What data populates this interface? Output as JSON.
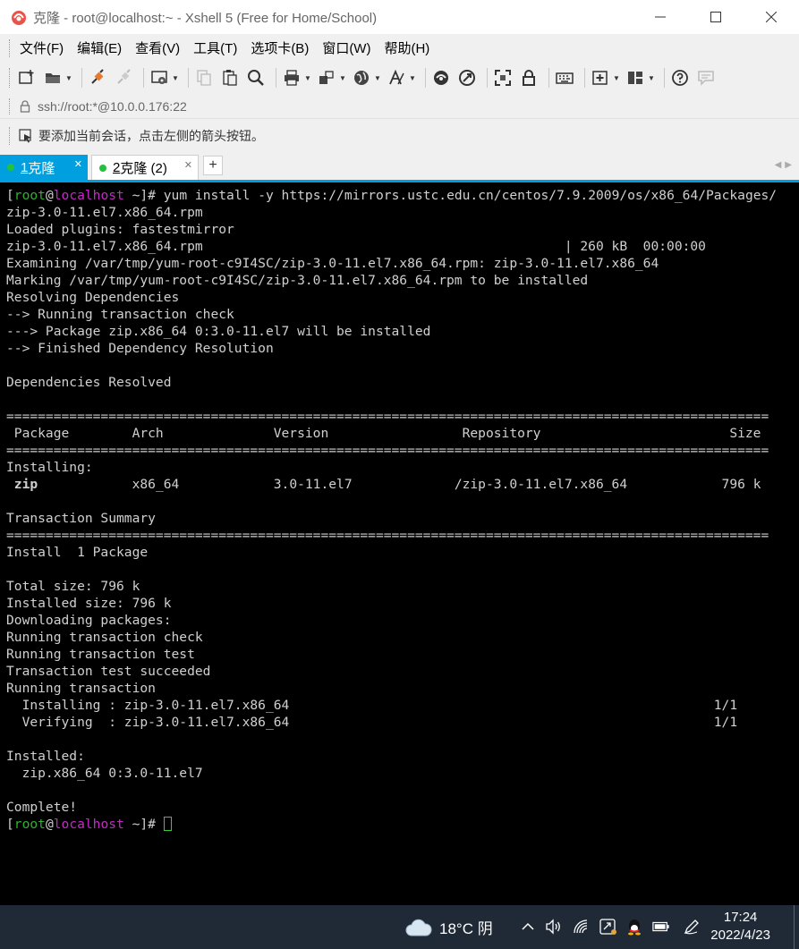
{
  "window": {
    "title": "克隆 - root@localhost:~ - Xshell 5 (Free for Home/School)",
    "controls": [
      "minimize-icon",
      "maximize-icon",
      "close-icon"
    ]
  },
  "menu": {
    "items": [
      "文件(F)",
      "编辑(E)",
      "查看(V)",
      "工具(T)",
      "选项卡(B)",
      "窗口(W)",
      "帮助(H)"
    ]
  },
  "toolbar": {
    "icons": [
      "new-session-icon",
      "open-folder-icon",
      "connect-icon",
      "disconnect-icon",
      "properties-icon",
      "copy-icon",
      "paste-icon",
      "find-icon",
      "print-icon",
      "transfer-icon",
      "globe-icon",
      "font-icon",
      "xftp-icon",
      "xmanager-icon",
      "fullscreen-icon",
      "lock-icon",
      "keyboard-icon",
      "new-tab-icon",
      "layout-icon",
      "help-icon",
      "chat-icon"
    ]
  },
  "address": {
    "url": "ssh://root:*@10.0.0.176:22"
  },
  "hint": {
    "text": "要添加当前会话，点击左侧的箭头按钮。"
  },
  "tabs": [
    {
      "number": "1",
      "label": "克隆",
      "active": true
    },
    {
      "number": "2",
      "label": "克隆 (2)",
      "active": false
    }
  ],
  "tab_add_label": "+",
  "terminal": {
    "prompt": {
      "open": "[",
      "user": "root",
      "at": "@",
      "host": "localhost",
      "rest": " ~]# "
    },
    "command": "yum install -y https://mirrors.ustc.edu.cn/centos/7.9.2009/os/x86_64/Packages/",
    "lines": [
      "zip-3.0-11.el7.x86_64.rpm",
      "Loaded plugins: fastestmirror",
      "zip-3.0-11.el7.x86_64.rpm                                              | 260 kB  00:00:00",
      "Examining /var/tmp/yum-root-c9I4SC/zip-3.0-11.el7.x86_64.rpm: zip-3.0-11.el7.x86_64",
      "Marking /var/tmp/yum-root-c9I4SC/zip-3.0-11.el7.x86_64.rpm to be installed",
      "Resolving Dependencies",
      "--> Running transaction check",
      "---> Package zip.x86_64 0:3.0-11.el7 will be installed",
      "--> Finished Dependency Resolution",
      "",
      "Dependencies Resolved",
      "",
      "=================================================================================================",
      " Package        Arch              Version                 Repository                        Size",
      "=================================================================================================",
      "Installing:",
      "__ZIP__",
      "",
      "Transaction Summary",
      "=================================================================================================",
      "Install  1 Package",
      "",
      "Total size: 796 k",
      "Installed size: 796 k",
      "Downloading packages:",
      "Running transaction check",
      "Running transaction test",
      "Transaction test succeeded",
      "Running transaction",
      "  Installing : zip-3.0-11.el7.x86_64                                                      1/1",
      "  Verifying  : zip-3.0-11.el7.x86_64                                                      1/1",
      "",
      "Installed:",
      "  zip.x86_64 0:3.0-11.el7",
      "",
      "Complete!"
    ],
    "package_row": {
      "name": "zip",
      "rest": "            x86_64            3.0-11.el7             /zip-3.0-11.el7.x86_64            796 k"
    }
  },
  "taskbar": {
    "weather": "18°C  阴",
    "time": "17:24",
    "date": "2022/4/23",
    "tray_icons": [
      "chevron-up-icon",
      "volume-icon",
      "wifi-icon",
      "ime-icon",
      "qq-icon",
      "battery-icon",
      "pen-icon"
    ]
  }
}
